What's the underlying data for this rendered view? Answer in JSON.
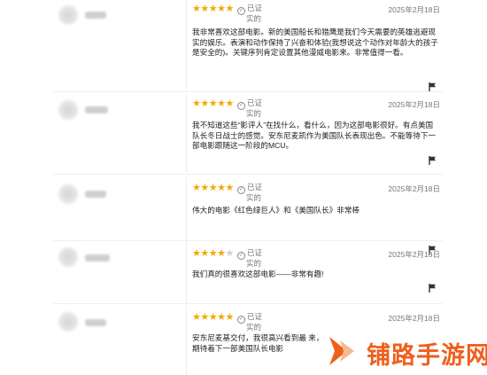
{
  "reviews": [
    {
      "rating": 5,
      "verified": [
        "已证",
        "实的"
      ],
      "date": "2025年2月18日",
      "text": "我非常喜欢这部电影。新的美国船长和猎鹰是我们今天需要的英雄逃避现实的娱乐。表演和动作保持了兴奋和体验(我想说这个动作对年龄大的孩子是安全的)。关键序列肯定设置其他漫威电影来。非常值得一看。"
    },
    {
      "rating": 5,
      "verified": [
        "已证",
        "实的"
      ],
      "date": "2025年2月18日",
      "text": "我不知道这些“影评人”在找什么，看什么，因为这部电影很好。有点美国队长冬日战士的感觉。安东尼麦凯作为美国队长表现出色。不能等待下一部电影跟随这一阶段的MCU。"
    },
    {
      "rating": 5,
      "verified": [
        "已证",
        "实的"
      ],
      "date": "2025年2月18日",
      "text": "伟大的电影《红色绿巨人》和《美国队长》非常棒"
    },
    {
      "rating": 4,
      "verified": [
        "已证",
        "实的"
      ],
      "date": "2025年2月18日",
      "text": "我们真的很喜欢这部电影——非常有趣!"
    },
    {
      "rating": 5,
      "verified": [
        "已证",
        "实的"
      ],
      "date": "2025年2月18日",
      "text": "安东尼麦基交付，我很高兴看到最 来，期待着下一部美国队长电影"
    }
  ],
  "watermark": {
    "text": "铺路手游网",
    "logo_icon": "arrow-logo-icon"
  },
  "colors": {
    "star": "#f2a900",
    "star_empty": "#cfcfcf",
    "watermark": "#ef5f1d"
  }
}
